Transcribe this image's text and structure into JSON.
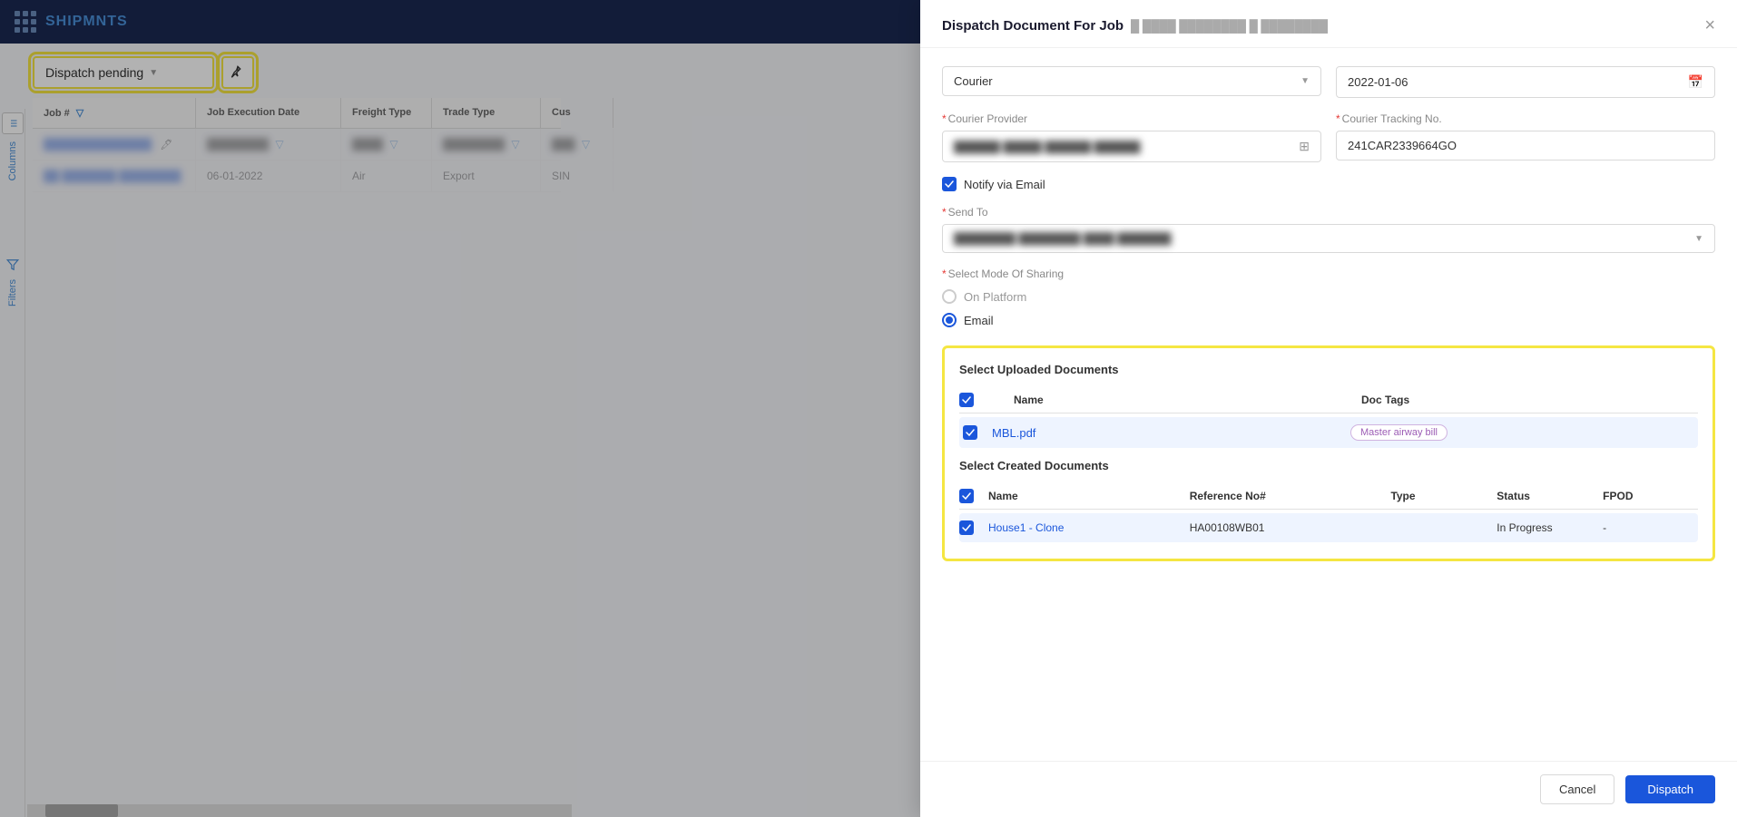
{
  "app": {
    "brand": "SHIPMNTS"
  },
  "nav": {
    "job_filter_label": "Job #",
    "job_filter_chevron": "▼"
  },
  "left_panel": {
    "filter_label": "Dispatch pending",
    "columns_label": "Columns",
    "filters_label": "Filters"
  },
  "table": {
    "headers": [
      "Job #",
      "Job Execution Date",
      "Freight Type",
      "Trade Type",
      "Cus"
    ],
    "row1": {
      "job": "██████████████",
      "date": "",
      "freight": "",
      "trade": "",
      "cus": ""
    },
    "row2": {
      "job": "██ ███████ ████████",
      "date": "06-01-2022",
      "freight": "Air",
      "trade": "Export",
      "cus": "SIN"
    }
  },
  "modal": {
    "title": "Dispatch Document For Job",
    "job_id": "█ ████ ████████ █ ████████",
    "close_label": "×",
    "type_dropdown": "Courier",
    "date_value": "2022-01-06",
    "courier_provider_label": "Courier Provider",
    "courier_provider_value": "██████ █████ ██████ ██████",
    "courier_tracking_label": "Courier Tracking No.",
    "courier_tracking_value": "241CAR2339664GO",
    "notify_email_label": "Notify via Email",
    "send_to_label": "Send To",
    "send_to_value": "████████ ████████ ████ ███████",
    "mode_label": "Select Mode Of Sharing",
    "mode_on_platform": "On Platform",
    "mode_email": "Email",
    "uploaded_docs_title": "Select Uploaded Documents",
    "uploaded_docs_col_name": "Name",
    "uploaded_docs_col_tags": "Doc Tags",
    "uploaded_file_name": "MBL.pdf",
    "uploaded_file_tag": "Master airway bill",
    "created_docs_title": "Select Created Documents",
    "created_col_name": "Name",
    "created_col_ref": "Reference No#",
    "created_col_type": "Type",
    "created_col_status": "Status",
    "created_col_fpod": "FPOD",
    "created_row1_name": "House1 - Clone",
    "created_row1_ref": "HA00108WB01",
    "created_row1_type": "",
    "created_row1_status": "In Progress",
    "created_row1_fpod": "-",
    "cancel_label": "Cancel",
    "dispatch_label": "Dispatch"
  }
}
